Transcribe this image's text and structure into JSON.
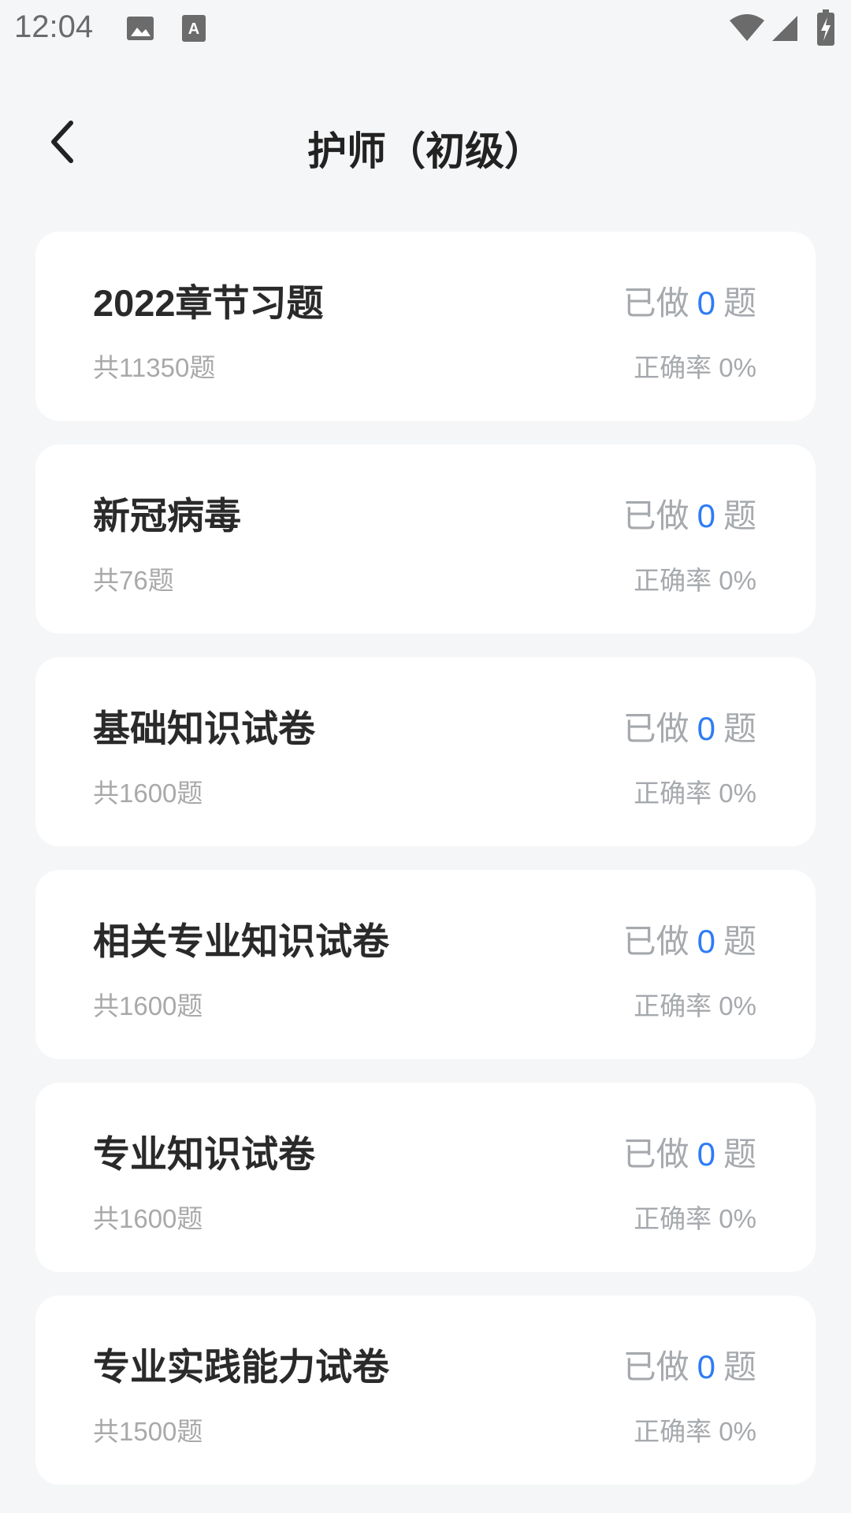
{
  "status_bar": {
    "time": "12:04",
    "icons": [
      "image-icon",
      "text-a-icon",
      "wifi-icon",
      "signal-icon",
      "battery-charging-icon"
    ]
  },
  "header": {
    "title": "护师（初级）",
    "back_icon": "chevron-left-icon"
  },
  "colors": {
    "accent": "#2e7cf6",
    "background": "#f5f6f7",
    "card": "#ffffff"
  },
  "items": [
    {
      "title": "2022章节习题",
      "count": "共11350题",
      "done_prefix": "已做",
      "done_value": "0",
      "done_suffix": "题",
      "accuracy": "正确率 0%"
    },
    {
      "title": "新冠病毒",
      "count": "共76题",
      "done_prefix": "已做",
      "done_value": "0",
      "done_suffix": "题",
      "accuracy": "正确率 0%"
    },
    {
      "title": "基础知识试卷",
      "count": "共1600题",
      "done_prefix": "已做",
      "done_value": "0",
      "done_suffix": "题",
      "accuracy": "正确率 0%"
    },
    {
      "title": "相关专业知识试卷",
      "count": "共1600题",
      "done_prefix": "已做",
      "done_value": "0",
      "done_suffix": "题",
      "accuracy": "正确率 0%"
    },
    {
      "title": "专业知识试卷",
      "count": "共1600题",
      "done_prefix": "已做",
      "done_value": "0",
      "done_suffix": "题",
      "accuracy": "正确率 0%"
    },
    {
      "title": "专业实践能力试卷",
      "count": "共1500题",
      "done_prefix": "已做",
      "done_value": "0",
      "done_suffix": "题",
      "accuracy": "正确率 0%"
    }
  ]
}
